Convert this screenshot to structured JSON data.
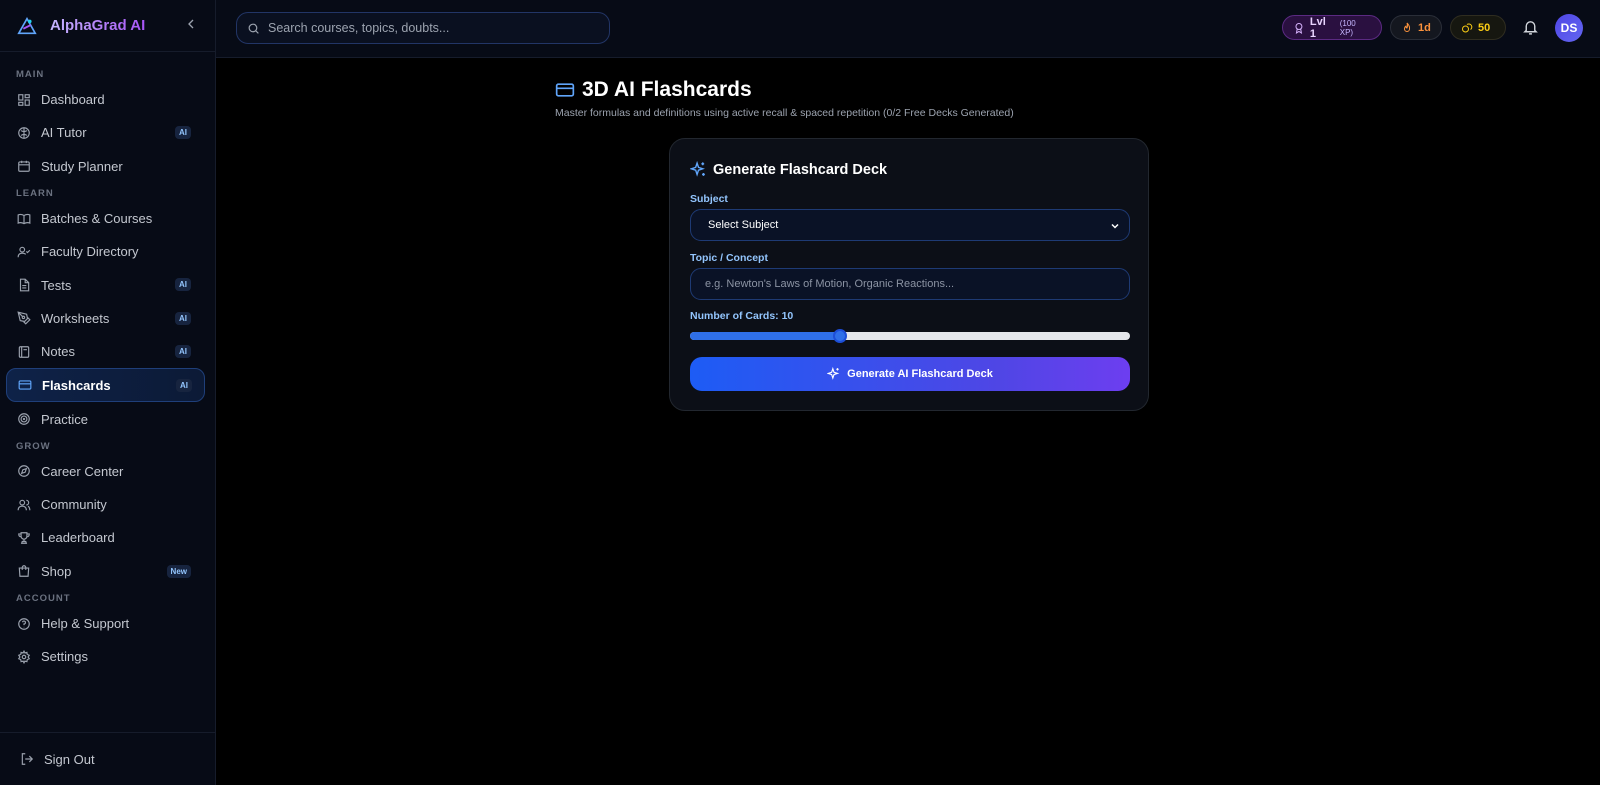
{
  "brand": {
    "name": "AlphaGrad AI"
  },
  "sidebar": {
    "sections": {
      "main": "MAIN",
      "learn": "LEARN",
      "grow": "GROW",
      "account": "ACCOUNT"
    },
    "items": {
      "dashboard": {
        "label": "Dashboard"
      },
      "ai_tutor": {
        "label": "AI Tutor",
        "badge": "AI"
      },
      "study_planner": {
        "label": "Study Planner"
      },
      "batches": {
        "label": "Batches & Courses"
      },
      "faculty": {
        "label": "Faculty Directory"
      },
      "tests": {
        "label": "Tests",
        "badge": "AI"
      },
      "worksheets": {
        "label": "Worksheets",
        "badge": "AI"
      },
      "notes": {
        "label": "Notes",
        "badge": "AI"
      },
      "flashcards": {
        "label": "Flashcards",
        "badge": "AI"
      },
      "practice": {
        "label": "Practice"
      },
      "career": {
        "label": "Career Center"
      },
      "community": {
        "label": "Community"
      },
      "leaderboard": {
        "label": "Leaderboard"
      },
      "shop": {
        "label": "Shop",
        "badge": "New"
      },
      "help": {
        "label": "Help & Support"
      },
      "settings": {
        "label": "Settings"
      }
    },
    "signout": "Sign Out"
  },
  "topbar": {
    "search_placeholder": "Search courses, topics, doubts...",
    "level": "Lvl 1",
    "xp": "(100 XP)",
    "streak": "1d",
    "coins": "50",
    "avatar_initials": "DS"
  },
  "page": {
    "title": "3D AI Flashcards",
    "subtitle": "Master formulas and definitions using active recall & spaced repetition (0/2 Free Decks Generated)"
  },
  "generator": {
    "title": "Generate Flashcard Deck",
    "subject_label": "Subject",
    "subject_value": "Select Subject",
    "topic_label": "Topic / Concept",
    "topic_placeholder": "e.g. Newton's Laws of Motion, Organic Reactions...",
    "cards_label": "Number of Cards: 10",
    "cards_fraction": 0.34,
    "button_label": "Generate AI Flashcard Deck"
  },
  "colors": {
    "accent": "#2f6fe8",
    "brand_purple": "#a855f7",
    "badge_text": "#93c5fd",
    "streak": "#fb923c",
    "coins": "#facc15"
  }
}
